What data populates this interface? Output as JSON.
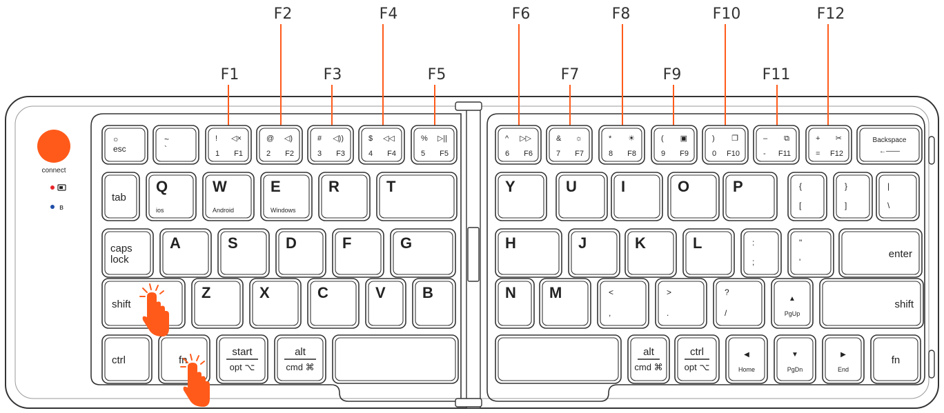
{
  "colors": {
    "accent": "#ff5a1a",
    "outline": "#333333",
    "led_red": "#e8252b",
    "led_blue": "#1f4ea8"
  },
  "connect_label": "connect",
  "status_icons": [
    "battery-icon",
    "bluetooth-icon"
  ],
  "fkey_callouts": [
    "F1",
    "F2",
    "F3",
    "F4",
    "F5",
    "F6",
    "F7",
    "F8",
    "F9",
    "F10",
    "F11",
    "F12"
  ],
  "left": {
    "row1": [
      {
        "top": "○",
        "bottom": "esc"
      },
      {
        "top": "~",
        "bottom": "`"
      },
      {
        "tl": "!",
        "tr": "◁×",
        "bl": "1",
        "br": "F1"
      },
      {
        "tl": "@",
        "tr": "◁)",
        "bl": "2",
        "br": "F2"
      },
      {
        "tl": "#",
        "tr": "◁))",
        "bl": "3",
        "br": "F3"
      },
      {
        "tl": "$",
        "tr": "◁◁",
        "bl": "4",
        "br": "F4"
      },
      {
        "tl": "%",
        "tr": "▷||",
        "bl": "5",
        "br": "F5"
      }
    ],
    "row2": [
      {
        "main": "tab"
      },
      {
        "main": "Q",
        "sub": "ios"
      },
      {
        "main": "W",
        "sub": "Android"
      },
      {
        "main": "E",
        "sub": "Windows"
      },
      {
        "main": "R"
      },
      {
        "main": "T"
      }
    ],
    "row3": [
      {
        "main": "caps lock"
      },
      {
        "main": "A"
      },
      {
        "main": "S"
      },
      {
        "main": "D"
      },
      {
        "main": "F"
      },
      {
        "main": "G"
      }
    ],
    "row4": [
      {
        "main": "shift"
      },
      {
        "main": "Z"
      },
      {
        "main": "X"
      },
      {
        "main": "C"
      },
      {
        "main": "V"
      },
      {
        "main": "B"
      }
    ],
    "row5": [
      {
        "main": "ctrl"
      },
      {
        "main": "fn"
      },
      {
        "top": "start",
        "bottom": "opt ⌥"
      },
      {
        "top": "alt",
        "bottom": "cmd ⌘"
      },
      {
        "main": ""
      }
    ]
  },
  "right": {
    "row1": [
      {
        "tl": "^",
        "tr": "▷▷",
        "bl": "6",
        "br": "F6"
      },
      {
        "tl": "&",
        "tr": "☼",
        "bl": "7",
        "br": "F7"
      },
      {
        "tl": "*",
        "tr": "☀",
        "bl": "8",
        "br": "F8"
      },
      {
        "tl": "(",
        "tr": "▣",
        "bl": "9",
        "br": "F9"
      },
      {
        "tl": ")",
        "tr": "❐",
        "bl": "0",
        "br": "F10"
      },
      {
        "tl": "–",
        "tr": "⧉",
        "bl": "-",
        "br": "F11"
      },
      {
        "tl": "+",
        "tr": "✂",
        "bl": "=",
        "br": "F12"
      },
      {
        "top": "Backspace",
        "bottom": "←——"
      }
    ],
    "row2": [
      {
        "main": "Y"
      },
      {
        "main": "U"
      },
      {
        "main": "I"
      },
      {
        "main": "O"
      },
      {
        "main": "P"
      },
      {
        "top": "{",
        "bottom": "["
      },
      {
        "top": "}",
        "bottom": "]"
      },
      {
        "top": "|",
        "bottom": "\\"
      }
    ],
    "row3": [
      {
        "main": "H"
      },
      {
        "main": "J"
      },
      {
        "main": "K"
      },
      {
        "main": "L"
      },
      {
        "top": ":",
        "bottom": ";"
      },
      {
        "top": "\"",
        "bottom": "'"
      },
      {
        "main": "enter"
      }
    ],
    "row4": [
      {
        "main": "N"
      },
      {
        "main": "M"
      },
      {
        "top": "<",
        "bottom": ","
      },
      {
        "top": ">",
        "bottom": "."
      },
      {
        "top": "?",
        "bottom": "/"
      },
      {
        "top": "▲",
        "bottom": "PgUp"
      },
      {
        "main": "shift"
      }
    ],
    "row5": [
      {
        "main": ""
      },
      {
        "top": "alt",
        "bottom": "cmd ⌘"
      },
      {
        "top": "ctrl",
        "bottom": "opt ⌥"
      },
      {
        "top": "◀",
        "bottom": "Home"
      },
      {
        "top": "▼",
        "bottom": "PgDn"
      },
      {
        "top": "▶",
        "bottom": "End"
      },
      {
        "main": "fn"
      }
    ]
  }
}
